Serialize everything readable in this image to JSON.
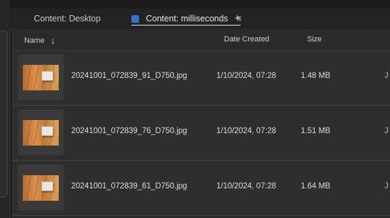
{
  "tabs": {
    "desktop_label": "Content: Desktop",
    "active_label": "Content: milliseconds",
    "add_symbol": "+",
    "menu_symbol": "≡",
    "active_color": "#3b6fd8"
  },
  "columns": {
    "name": "Name",
    "sort_indicator": "↓",
    "date": "Date Created",
    "size": "Size"
  },
  "files": [
    {
      "name": "20241001_072839_91_D750.jpg",
      "date": "1/10/2024, 07:28",
      "size": "1.48 MB",
      "extra": "J"
    },
    {
      "name": "20241001_072839_76_D750.jpg",
      "date": "1/10/2024, 07:28",
      "size": "1.51 MB",
      "extra": "J"
    },
    {
      "name": "20241001_072839_61_D750.jpg",
      "date": "1/10/2024, 07:28",
      "size": "1.64 MB",
      "extra": "J"
    }
  ]
}
